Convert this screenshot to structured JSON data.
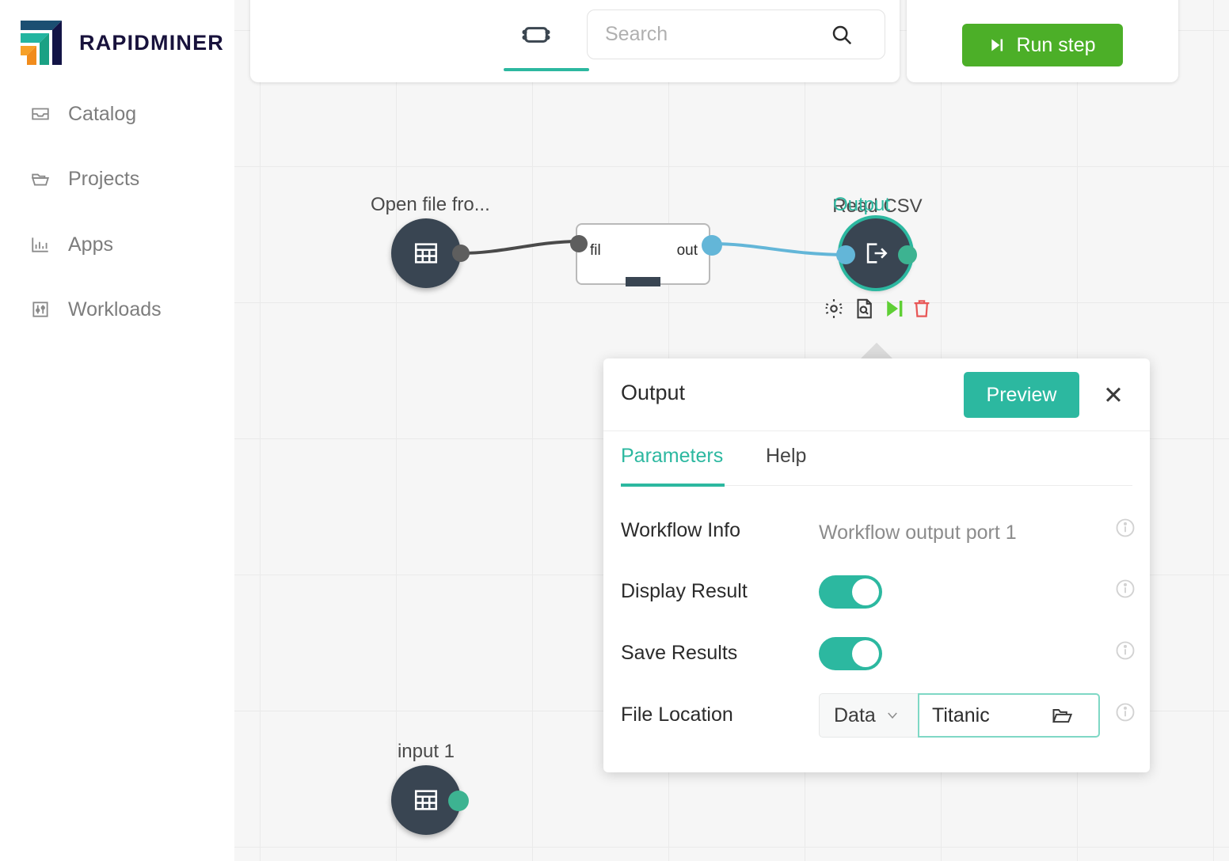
{
  "app": {
    "brand": "RAPIDMINER"
  },
  "sidebar": {
    "items": [
      {
        "label": "Catalog",
        "icon": "inbox-icon"
      },
      {
        "label": "Projects",
        "icon": "folder-icon"
      },
      {
        "label": "Apps",
        "icon": "bar-chart-icon"
      },
      {
        "label": "Workloads",
        "icon": "sliders-icon"
      }
    ]
  },
  "toolbar": {
    "tabs": [
      {
        "name": "design-view",
        "icon": "node-box-icon",
        "active": true
      },
      {
        "name": "data-view",
        "icon": "database-icon",
        "active": false
      },
      {
        "name": "branch-view",
        "icon": "branch-icon",
        "active": false
      }
    ],
    "search": {
      "placeholder": "Search",
      "value": ""
    },
    "run_step_label": "Run step"
  },
  "canvas": {
    "nodes": [
      {
        "name": "open-file-node",
        "label": "Open file fro...",
        "icon": "table-icon",
        "selected": false
      },
      {
        "name": "read-csv-node",
        "label": "Read CSV",
        "in_port": "fil",
        "out_port": "out"
      },
      {
        "name": "output-node",
        "label": "Output",
        "icon": "export-icon",
        "selected": true
      },
      {
        "name": "input-1-node",
        "label": "input 1",
        "icon": "table-icon",
        "selected": false
      }
    ],
    "node_actions": [
      {
        "name": "settings-action",
        "icon": "gear-icon"
      },
      {
        "name": "preview-action",
        "icon": "document-search-icon"
      },
      {
        "name": "run-action",
        "icon": "step-forward-icon"
      },
      {
        "name": "delete-action",
        "icon": "trash-icon"
      }
    ]
  },
  "dialog": {
    "title": "Output",
    "preview_label": "Preview",
    "close_label": "✕",
    "tabs": [
      {
        "label": "Parameters",
        "active": true
      },
      {
        "label": "Help",
        "active": false
      }
    ],
    "params": {
      "workflow_info": {
        "label": "Workflow Info",
        "value": "Workflow output port 1"
      },
      "display_result": {
        "label": "Display Result",
        "on": true
      },
      "save_results": {
        "label": "Save Results",
        "on": true
      },
      "file_location": {
        "label": "File Location",
        "select_value": "Data",
        "input_value": "Titanic"
      }
    }
  },
  "colors": {
    "accent_teal": "#2cb8a0",
    "run_green": "#4caf28",
    "node_dark": "#394552",
    "link_blue": "#63b6d8",
    "danger_red": "#e85757"
  }
}
